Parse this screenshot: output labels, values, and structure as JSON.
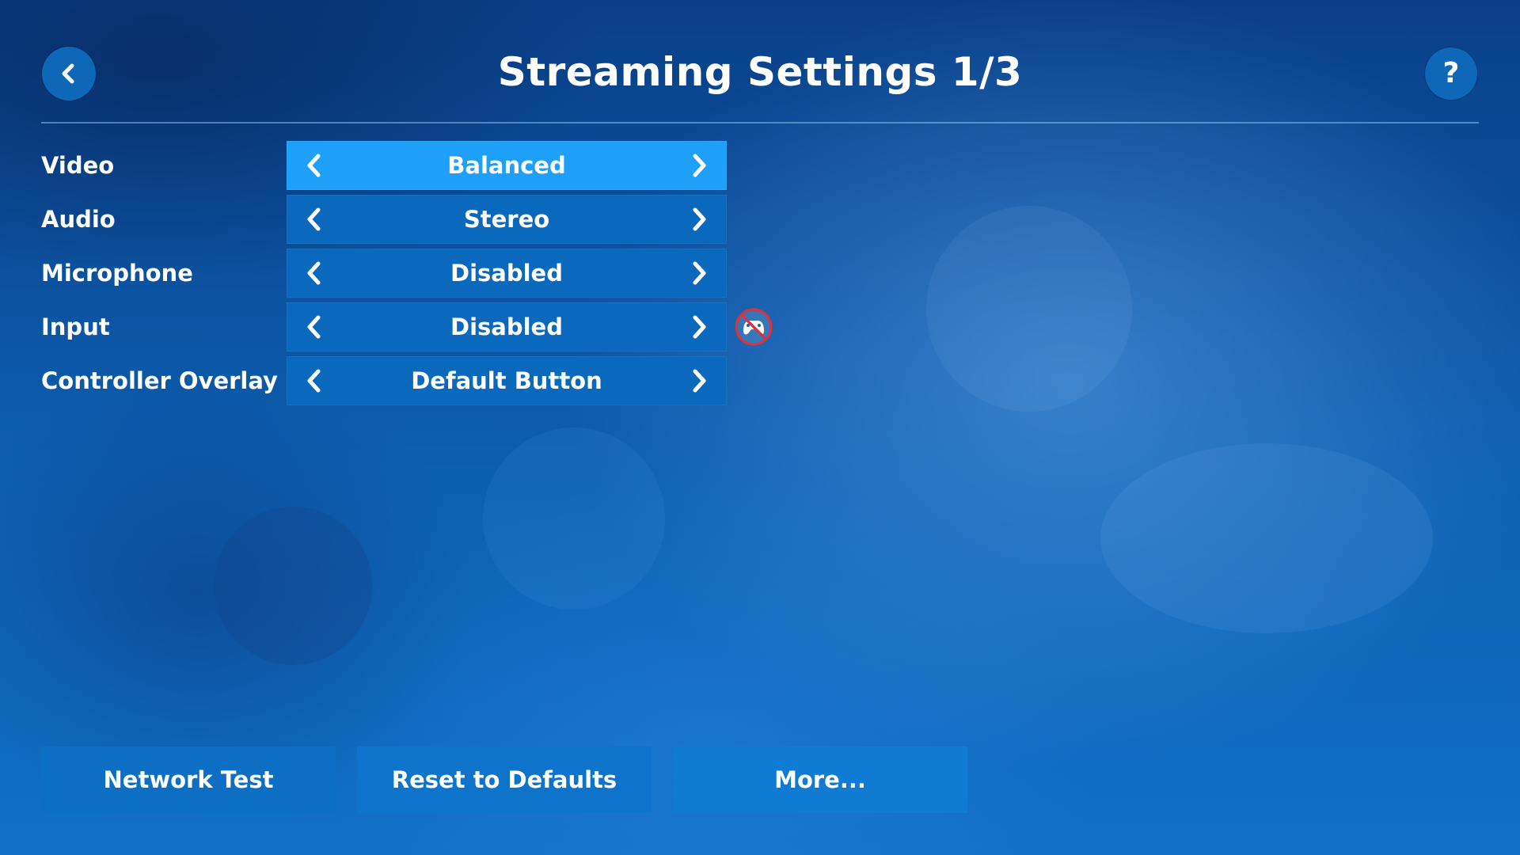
{
  "header": {
    "title": "Streaming Settings 1/3",
    "back_icon": "chevron-left-icon",
    "help_label": "?"
  },
  "settings": [
    {
      "label": "Video",
      "value": "Balanced",
      "active": true
    },
    {
      "label": "Audio",
      "value": "Stereo",
      "active": false
    },
    {
      "label": "Microphone",
      "value": "Disabled",
      "active": false
    },
    {
      "label": "Input",
      "value": "Disabled",
      "active": false,
      "warning_icon": "controller-disabled-icon"
    },
    {
      "label": "Controller Overlay",
      "value": "Default Button",
      "active": false
    }
  ],
  "buttons": {
    "network_test": "Network Test",
    "reset_defaults": "Reset to Defaults",
    "more": "More..."
  },
  "colors": {
    "background": "#0c57a3",
    "selector": "#0b69bd",
    "selector_active": "#1ea0f8",
    "button": "#0d6fc4",
    "warning": "#e0303a"
  }
}
